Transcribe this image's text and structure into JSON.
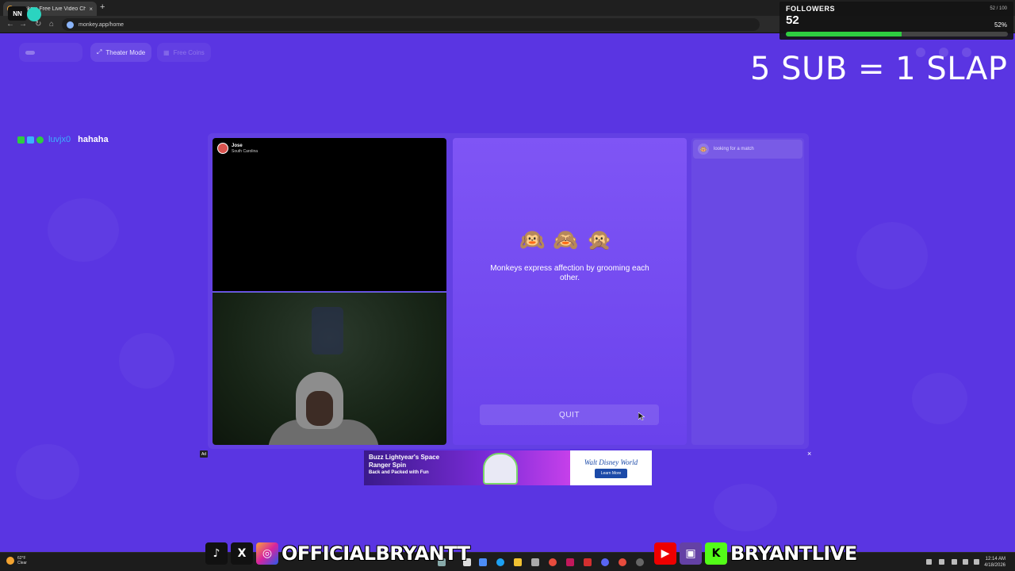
{
  "browser": {
    "tab_title": "Monkey: Free Live Video Chat",
    "tab_close": "×",
    "new_tab": "+",
    "url": "monkey.app/home"
  },
  "stream_overlay": {
    "followers_title": "FOLLOWERS",
    "followers_count": "52",
    "followers_progress": 0.52,
    "followers_small": "52 / 100",
    "progress_label": "52%",
    "sub_slap_text": "5 SUB = 1 SLAP"
  },
  "toolbar": {
    "theater_mode_label": "Theater Mode",
    "free_coins_label": "Free Coins"
  },
  "chat": {
    "username": "luvjx0",
    "message": "hahaha"
  },
  "video": {
    "remote_name": "Jose",
    "remote_location": "South Carolina"
  },
  "info": {
    "emoji": "🙉🙈🙊",
    "fact": "Monkeys express affection by grooming each other.",
    "quit_label": "QUIT"
  },
  "match": {
    "status": "looking for a match"
  },
  "ad": {
    "label": "Ad",
    "close": "×",
    "headline": "Buzz Lightyear's Space Ranger Spin",
    "subline": "Back and Packed with Fun",
    "brand": "Walt Disney World",
    "cta": "Learn More"
  },
  "taskbar": {
    "temp": "62°F",
    "condition": "Clear",
    "time": "12:14 AM",
    "date": "4/18/2026"
  },
  "social": {
    "handle_left": "OFFICIALBRYANTT",
    "handle_right": "BRYANTLIVE"
  },
  "colors": {
    "background": "#5a35e2",
    "info_panel": "#7f55f5",
    "followers_bar": "#2ecc40",
    "chat_username": "#3cb0ff"
  }
}
